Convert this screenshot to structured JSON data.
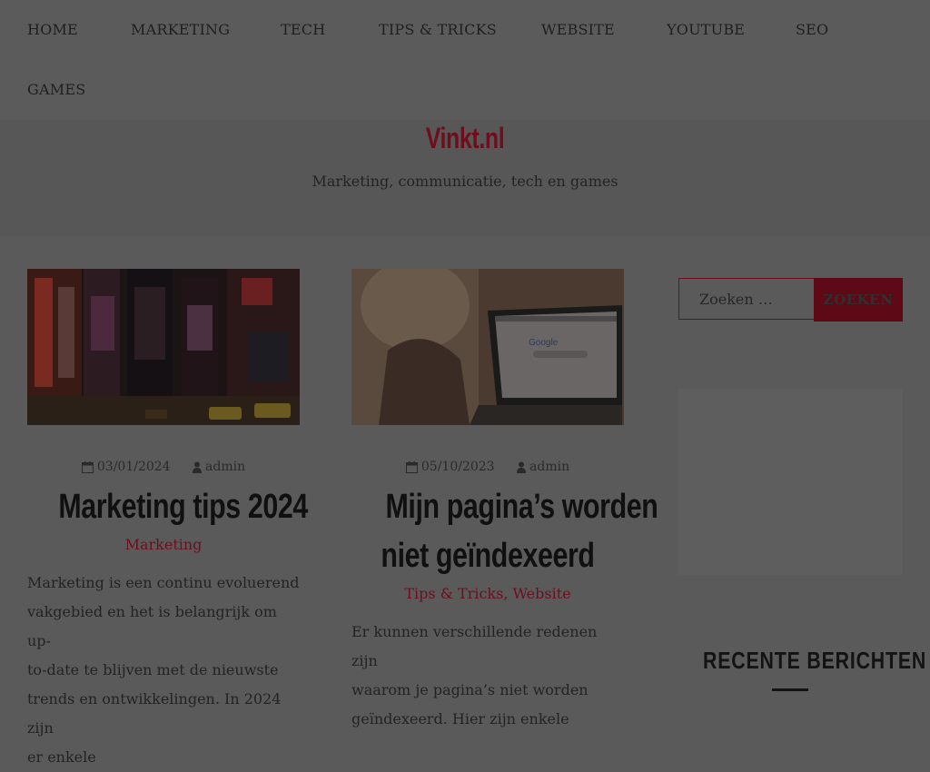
{
  "nav": {
    "items": [
      {
        "label": "HOME"
      },
      {
        "label": "MARKETING"
      },
      {
        "label": "TECH"
      },
      {
        "label": "TIPS & TRICKS"
      },
      {
        "label": "WEBSITE"
      },
      {
        "label": "YOUTUBE"
      },
      {
        "label": "SEO"
      },
      {
        "label": "GAMES"
      }
    ]
  },
  "header": {
    "site_title": "Vinkt.nl",
    "tagline": "Marketing, communicatie, tech en games"
  },
  "posts": [
    {
      "date": "03/01/2024",
      "author": "admin",
      "title": "Marketing tips 2024",
      "categories": [
        "Marketing"
      ],
      "excerpt_lines": [
        "Marketing is een continu evoluerend",
        "vakgebied en het is belangrijk om up-",
        "to-date te blijven met de nieuwste",
        "trends en ontwikkelingen. In 2024 zijn",
        "er enkele"
      ],
      "image_icon": "city-night-image"
    },
    {
      "date": "05/10/2023",
      "author": "admin",
      "title_lines": [
        "Mijn pagina’s worden",
        "niet geïndexeerd"
      ],
      "categories": [
        "Tips & Tricks",
        "Website"
      ],
      "category_separator": ",",
      "excerpt_lines": [
        "Er kunnen verschillende redenen zijn",
        "waarom je pagina’s niet worden",
        "geïndexeerd. Hier zijn enkele"
      ],
      "image_icon": "laptop-google-image",
      "image_text": "Google"
    }
  ],
  "sidebar": {
    "search_placeholder": "Zoeken …",
    "search_button": "ZOEKEN",
    "recent_title": "RECENTE BERICHTEN"
  },
  "colors": {
    "accent": "#6e0e1c",
    "overlay_bg": "#5a5a5a"
  }
}
